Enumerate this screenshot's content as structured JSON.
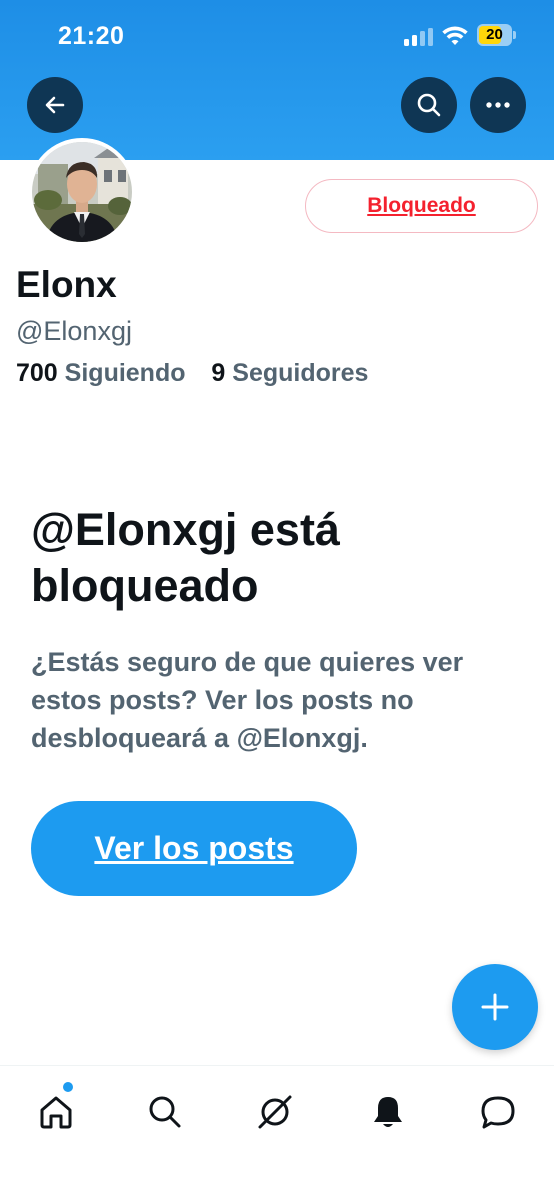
{
  "status_bar": {
    "time": "21:20",
    "battery_level": "20",
    "icons": [
      "signal-icon",
      "wifi-icon",
      "battery-icon"
    ]
  },
  "header": {
    "icons": [
      "arrow-left-icon",
      "search-icon",
      "more-icon"
    ]
  },
  "profile": {
    "display_name": "Elonx",
    "handle": "@Elonxgj",
    "following_count": "700",
    "following_label": "Siguiendo",
    "followers_count": "9",
    "followers_label": "Seguidores",
    "blocked_button_label": "Bloqueado"
  },
  "blocked_notice": {
    "title": "@Elonxgj está bloqueado",
    "description": "¿Estás seguro de que quieres ver estos posts? Ver los posts no desbloqueará a @Elonxgj.",
    "view_posts_label": "Ver los posts"
  },
  "fab": {
    "icon": "plus-icon"
  },
  "bottom_nav": {
    "items": [
      "home-icon",
      "search-icon",
      "grok-icon",
      "notifications-icon",
      "messages-icon"
    ],
    "home_has_new": true
  },
  "colors": {
    "banner": "#1e8ee6",
    "accent": "#1d9bf0",
    "blocked_red": "#f4212e",
    "header_button": "#0f3654",
    "secondary_text": "#536471"
  }
}
